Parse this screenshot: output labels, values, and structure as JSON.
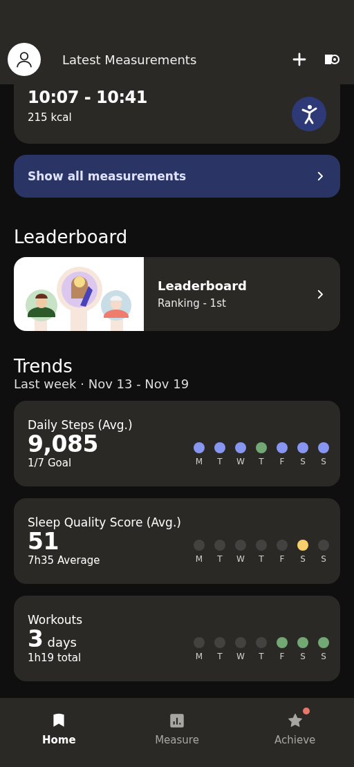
{
  "header": {
    "title": "Latest Measurements"
  },
  "latest": {
    "time": "10:07 - 10:41",
    "energy": "215 kcal"
  },
  "show_all": {
    "label": "Show all measurements"
  },
  "leaderboard": {
    "heading": "Leaderboard",
    "title": "Leaderboard",
    "subtitle": "Ranking - 1st"
  },
  "trends": {
    "heading": "Trends",
    "subtitle": "Last week · Nov 13 - Nov 19",
    "cards": [
      {
        "title": "Daily Steps (Avg.)",
        "value": "9,085",
        "caption": "1/7 Goal",
        "days": [
          {
            "label": "M",
            "color": "#8796f0"
          },
          {
            "label": "T",
            "color": "#8796f0"
          },
          {
            "label": "W",
            "color": "#8796f0"
          },
          {
            "label": "T",
            "color": "#72a874"
          },
          {
            "label": "F",
            "color": "#8796f0"
          },
          {
            "label": "S",
            "color": "#8796f0"
          },
          {
            "label": "S",
            "color": "#8796f0"
          }
        ]
      },
      {
        "title": "Sleep Quality Score (Avg.)",
        "value": "51",
        "caption": "7h35 Average",
        "days": [
          {
            "label": "M",
            "color": "#444240"
          },
          {
            "label": "T",
            "color": "#444240"
          },
          {
            "label": "W",
            "color": "#444240"
          },
          {
            "label": "T",
            "color": "#444240"
          },
          {
            "label": "F",
            "color": "#444240"
          },
          {
            "label": "S",
            "color": "#f7cf6a"
          },
          {
            "label": "S",
            "color": "#444240"
          }
        ]
      },
      {
        "title": "Workouts",
        "value": "3",
        "unit": "days",
        "caption": "1h19 total",
        "days": [
          {
            "label": "M",
            "color": "#444240"
          },
          {
            "label": "T",
            "color": "#444240"
          },
          {
            "label": "W",
            "color": "#444240"
          },
          {
            "label": "T",
            "color": "#444240"
          },
          {
            "label": "F",
            "color": "#72a874"
          },
          {
            "label": "S",
            "color": "#72a874"
          },
          {
            "label": "S",
            "color": "#72a874"
          }
        ]
      }
    ]
  },
  "nav": [
    {
      "label": "Home",
      "selected": true,
      "badge": false
    },
    {
      "label": "Measure",
      "selected": false,
      "badge": false
    },
    {
      "label": "Achieve",
      "selected": false,
      "badge": true
    }
  ]
}
